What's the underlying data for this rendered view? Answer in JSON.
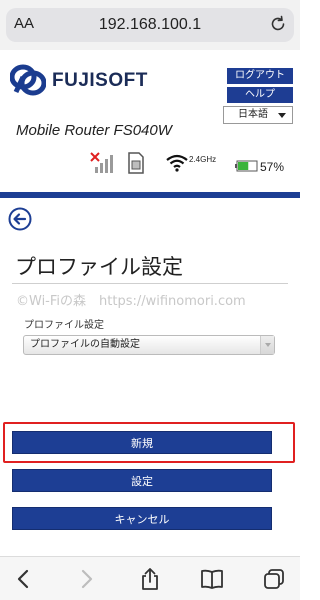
{
  "browser": {
    "aa_label": "AA",
    "url": "192.168.100.1",
    "icons": [
      "reload-icon",
      "back-arrow-icon",
      "forward-arrow-icon",
      "share-icon",
      "bookmarks-icon",
      "tabs-icon"
    ]
  },
  "header": {
    "brand": "FUJISOFT",
    "model": "Mobile Router FS040W",
    "logout_label": "ログアウト",
    "help_label": "ヘルプ",
    "language": "日本語"
  },
  "status": {
    "wifi_band": "2.4GHz",
    "battery_percent": "57%",
    "battery_level": 0.57,
    "icons": [
      "no-signal-icon",
      "sim-card-icon",
      "wifi-icon",
      "battery-icon"
    ]
  },
  "page": {
    "title": "プロファイル設定",
    "watermark": "©Wi-Fiの森　https://wifinomori.com",
    "field_label": "プロファイル設定",
    "field_value": "プロファイルの自動設定"
  },
  "actions": {
    "new_label": "新規",
    "settings_label": "設定",
    "cancel_label": "キャンセル"
  },
  "colors": {
    "brand_blue": "#1d3e94",
    "highlight_red": "#e02020",
    "battery_green": "#3cb43c"
  }
}
